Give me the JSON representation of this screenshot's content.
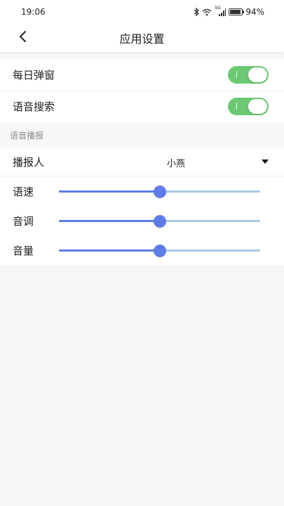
{
  "status_bar": {
    "time": "19:06",
    "battery": "94%",
    "signal_tag": "5G",
    "icons": [
      "bluetooth-icon",
      "wifi-icon",
      "cellular-signal-icon",
      "battery-icon"
    ]
  },
  "header": {
    "title": "应用设置",
    "back_icon": "chevron-left-icon"
  },
  "toggles": [
    {
      "label": "每日弹窗",
      "on": true
    },
    {
      "label": "语音搜索",
      "on": true
    }
  ],
  "voice_section": {
    "title": "语音播报",
    "speaker": {
      "label": "播报人",
      "value": "小燕"
    },
    "sliders": [
      {
        "label": "语速",
        "value": 0.5
      },
      {
        "label": "音调",
        "value": 0.5
      },
      {
        "label": "音量",
        "value": 0.5
      }
    ]
  },
  "colors": {
    "switch_on": "#6cc873",
    "slider_active": "#5f7be6",
    "slider_inactive": "#a9c8e6",
    "page_background": "#f7f7f7"
  }
}
